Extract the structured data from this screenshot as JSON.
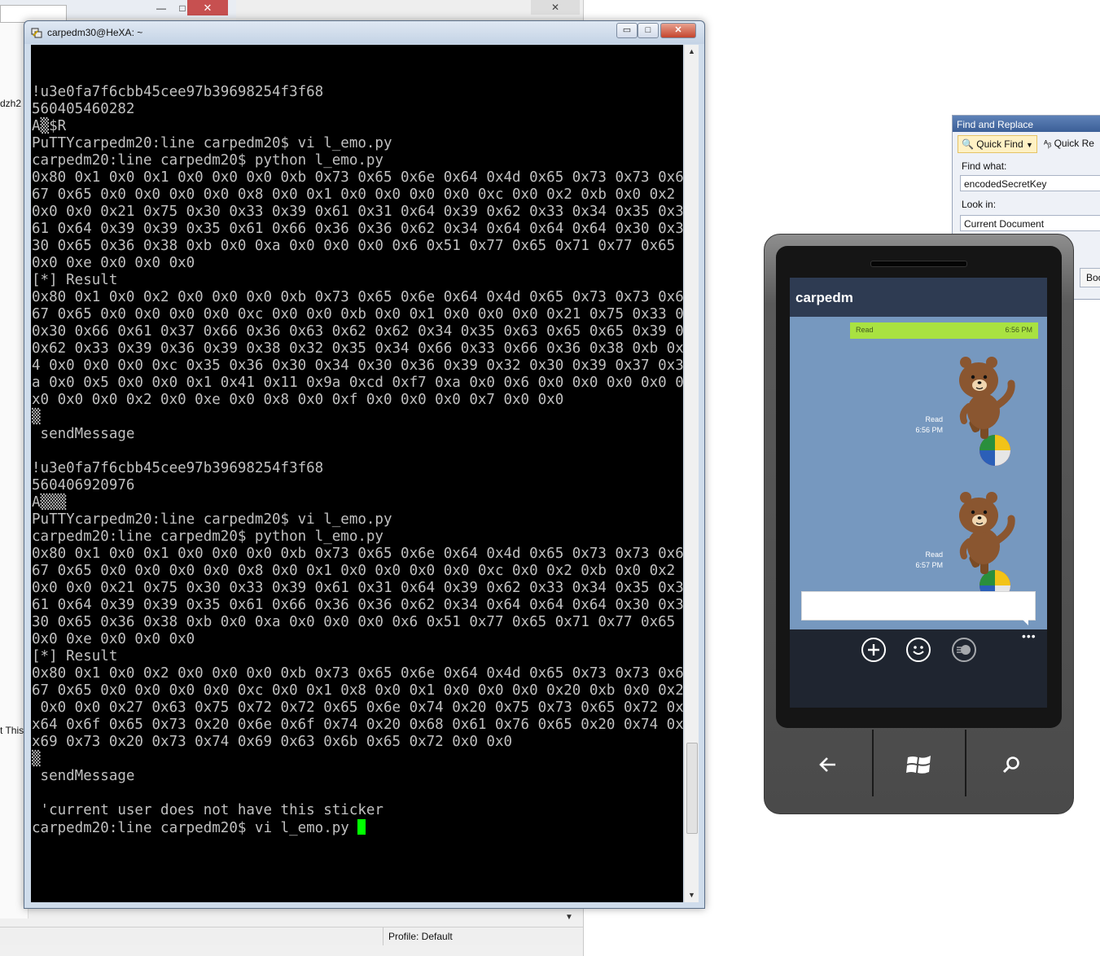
{
  "background_window": {
    "minimize": "—",
    "maximize": "□",
    "close": "✕",
    "left_label_1": "dzh2",
    "left_label_2": "t This",
    "status_profile": "Profile: Default"
  },
  "putty": {
    "title": "carpedm30@HeXA: ~",
    "minimize": "▭",
    "maximize": "□",
    "close": "✕",
    "terminal_lines": [
      "!u3e0fa7f6cbb45cee97b39698254f3f68",
      "560405460282",
      "A▒$R",
      "PuTTYcarpedm20:line carpedm20$ vi l_emo.py",
      "carpedm20:line carpedm20$ python l_emo.py",
      "0x80 0x1 0x0 0x1 0x0 0x0 0x0 0xb 0x73 0x65 0x6e 0x64 0x4d 0x65 0x73 0x73 0x61 0x",
      "67 0x65 0x0 0x0 0x0 0x0 0x8 0x0 0x1 0x0 0x0 0x0 0x0 0xc 0x0 0x2 0xb 0x0 0x2 0x0",
      "0x0 0x0 0x21 0x75 0x30 0x33 0x39 0x61 0x31 0x64 0x39 0x62 0x33 0x34 0x35 0x37 0x",
      "61 0x64 0x39 0x39 0x35 0x61 0x66 0x36 0x36 0x62 0x34 0x64 0x64 0x64 0x30 0x38 0x",
      "30 0x65 0x36 0x38 0xb 0x0 0xa 0x0 0x0 0x0 0x6 0x51 0x77 0x65 0x71 0x77 0x65 0x2",
      "0x0 0xe 0x0 0x0 0x0",
      "[*] Result",
      "0x80 0x1 0x0 0x2 0x0 0x0 0x0 0xb 0x73 0x65 0x6e 0x64 0x4d 0x65 0x73 0x73 0x61 0x",
      "67 0x65 0x0 0x0 0x0 0x0 0xc 0x0 0x0 0xb 0x0 0x1 0x0 0x0 0x0 0x21 0x75 0x33 0x65",
      "0x30 0x66 0x61 0x37 0x66 0x36 0x63 0x62 0x62 0x34 0x35 0x63 0x65 0x65 0x39 0x37",
      "0x62 0x33 0x39 0x36 0x39 0x38 0x32 0x35 0x34 0x66 0x33 0x66 0x36 0x38 0xb 0x0 0x",
      "4 0x0 0x0 0x0 0xc 0x35 0x36 0x30 0x34 0x30 0x36 0x39 0x32 0x30 0x39 0x37 0x36 0x",
      "a 0x0 0x5 0x0 0x0 0x1 0x41 0x11 0x9a 0xcd 0xf7 0xa 0x0 0x6 0x0 0x0 0x0 0x0 0x0 0",
      "x0 0x0 0x0 0x2 0x0 0xe 0x0 0x8 0x0 0xf 0x0 0x0 0x0 0x7 0x0 0x0",
      "▒",
      " sendMessage",
      "",
      "!u3e0fa7f6cbb45cee97b39698254f3f68",
      "560406920976",
      "A▒▒▒",
      "PuTTYcarpedm20:line carpedm20$ vi l_emo.py",
      "carpedm20:line carpedm20$ python l_emo.py",
      "0x80 0x1 0x0 0x1 0x0 0x0 0x0 0xb 0x73 0x65 0x6e 0x64 0x4d 0x65 0x73 0x73 0x61 0x",
      "67 0x65 0x0 0x0 0x0 0x0 0x8 0x0 0x1 0x0 0x0 0x0 0x0 0xc 0x0 0x2 0xb 0x0 0x2 0x0",
      "0x0 0x0 0x21 0x75 0x30 0x33 0x39 0x61 0x31 0x64 0x39 0x62 0x33 0x34 0x35 0x37 0x",
      "61 0x64 0x39 0x39 0x35 0x61 0x66 0x36 0x36 0x62 0x34 0x64 0x64 0x64 0x30 0x38 0x",
      "30 0x65 0x36 0x38 0xb 0x0 0xa 0x0 0x0 0x0 0x6 0x51 0x77 0x65 0x71 0x77 0x65 0x2",
      "0x0 0xe 0x0 0x0 0x0",
      "[*] Result",
      "0x80 0x1 0x0 0x2 0x0 0x0 0x0 0xb 0x73 0x65 0x6e 0x64 0x4d 0x65 0x73 0x73 0x61 0x",
      "67 0x65 0x0 0x0 0x0 0x0 0xc 0x0 0x1 0x8 0x0 0x1 0x0 0x0 0x0 0x20 0xb 0x0 0x2 0x0",
      " 0x0 0x0 0x27 0x63 0x75 0x72 0x72 0x65 0x6e 0x74 0x20 0x75 0x73 0x65 0x72 0x20 0",
      "x64 0x6f 0x65 0x73 0x20 0x6e 0x6f 0x74 0x20 0x68 0x61 0x76 0x65 0x20 0x74 0x68 0",
      "x69 0x73 0x20 0x73 0x74 0x69 0x63 0x6b 0x65 0x72 0x0 0x0",
      "▒",
      " sendMessage",
      "",
      " 'current user does not have this sticker",
      "carpedm20:line carpedm20$ vi l_emo.py "
    ]
  },
  "find_replace": {
    "title": "Find and Replace",
    "quick_find_tab": "Quick Find",
    "quick_replace_tab": "Quick Re",
    "find_what_label": "Find what:",
    "find_what_value": "encodedSecretKey",
    "look_in_label": "Look in:",
    "look_in_value": "Current Document",
    "button_partial": "Boo"
  },
  "phone": {
    "chat_title": "carpedm",
    "messages": [
      {
        "status": "Read",
        "time": "6:56 PM"
      },
      {
        "status": "Read",
        "time": "6:56 PM"
      },
      {
        "status": "Read",
        "time": "6:57 PM"
      }
    ],
    "more_dots": "•••",
    "colors": {
      "chat_background": "#7698bf",
      "header": "#2e3b52",
      "sent_bubble": "#a9e241",
      "appbar": "#1f2530"
    }
  }
}
